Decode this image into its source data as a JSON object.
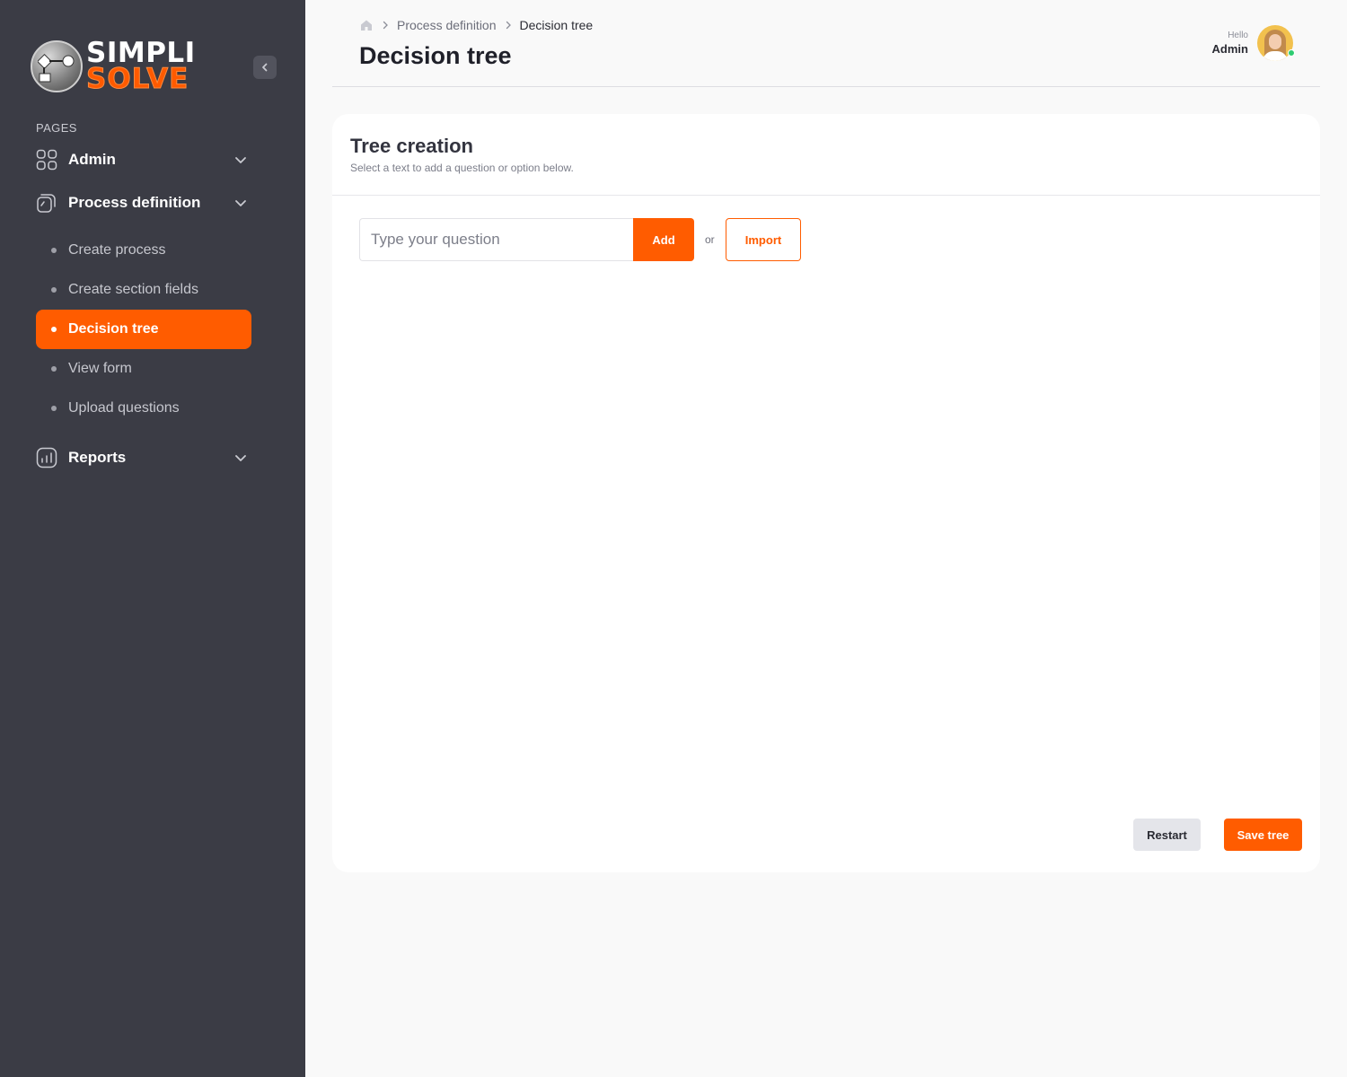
{
  "brand": {
    "name_line1": "SIMPLI",
    "name_line2": "SOLVE",
    "accent_color": "#ff5c00",
    "sidebar_color": "#3b3c45"
  },
  "sidebar": {
    "section_label": "PAGES",
    "groups": [
      {
        "label": "Admin",
        "icon": "grid-icon",
        "expanded": false
      },
      {
        "label": "Process definition",
        "icon": "document-stack-icon",
        "expanded": true,
        "items": [
          {
            "label": "Create process",
            "active": false
          },
          {
            "label": "Create section fields",
            "active": false
          },
          {
            "label": "Decision tree",
            "active": true
          },
          {
            "label": "View form",
            "active": false
          },
          {
            "label": "Upload questions",
            "active": false
          }
        ]
      },
      {
        "label": "Reports",
        "icon": "chart-icon",
        "expanded": false
      }
    ]
  },
  "header": {
    "breadcrumb": [
      "Process definition",
      "Decision tree"
    ],
    "title": "Decision tree",
    "user": {
      "greeting": "Hello",
      "name": "Admin",
      "status": "online"
    }
  },
  "card": {
    "title": "Tree creation",
    "subtitle": "Select a text to add a question or option below.",
    "question_input": {
      "placeholder": "Type your question",
      "value": ""
    },
    "add_label": "Add",
    "or_label": "or",
    "import_label": "Import",
    "restart_label": "Restart",
    "save_label": "Save tree"
  }
}
